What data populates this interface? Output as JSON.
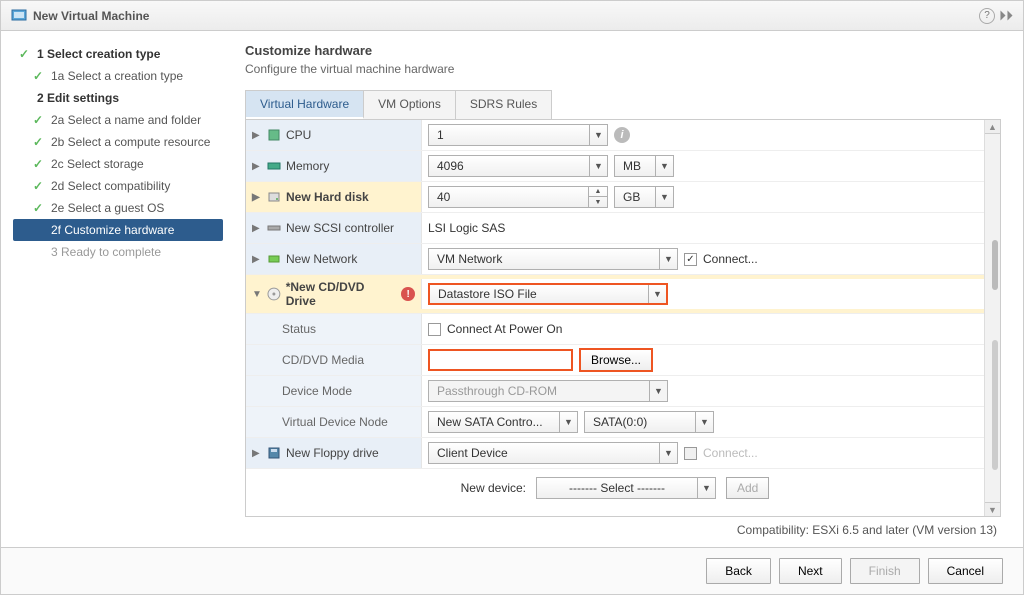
{
  "titlebar": {
    "title": "New Virtual Machine"
  },
  "sidebar": {
    "steps": [
      {
        "label": "1  Select creation type",
        "major": true,
        "check": true
      },
      {
        "label": "1a  Select a creation type",
        "sub": true,
        "check": true
      },
      {
        "label": "2  Edit settings",
        "major": true,
        "check": false
      },
      {
        "label": "2a  Select a name and folder",
        "sub": true,
        "check": true
      },
      {
        "label": "2b  Select a compute resource",
        "sub": true,
        "check": true
      },
      {
        "label": "2c  Select storage",
        "sub": true,
        "check": true
      },
      {
        "label": "2d  Select compatibility",
        "sub": true,
        "check": true
      },
      {
        "label": "2e  Select a guest OS",
        "sub": true,
        "check": true
      },
      {
        "label": "2f  Customize hardware",
        "sub": true,
        "check": false,
        "active": true
      },
      {
        "label": "3  Ready to complete",
        "sub": true,
        "check": false,
        "dim": true
      }
    ]
  },
  "content": {
    "title": "Customize hardware",
    "subtitle": "Configure the virtual machine hardware"
  },
  "tabs": [
    {
      "label": "Virtual Hardware",
      "active": true
    },
    {
      "label": "VM Options"
    },
    {
      "label": "SDRS Rules"
    }
  ],
  "hardware": {
    "cpu": {
      "label": "CPU",
      "value": "1"
    },
    "memory": {
      "label": "Memory",
      "value": "4096",
      "unit": "MB"
    },
    "harddisk": {
      "label": "New Hard disk",
      "value": "40",
      "unit": "GB"
    },
    "scsi": {
      "label": "New SCSI controller",
      "value": "LSI Logic SAS"
    },
    "network": {
      "label": "New Network",
      "value": "VM Network",
      "connect": "Connect...",
      "checked": true
    },
    "cdrom": {
      "label": "*New CD/DVD Drive",
      "value": "Datastore ISO File",
      "status_label": "Status",
      "status_text": "Connect At Power On",
      "media_label": "CD/DVD Media",
      "media_value": "",
      "browse": "Browse...",
      "mode_label": "Device Mode",
      "mode_value": "Passthrough CD-ROM",
      "node_label": "Virtual Device Node",
      "node_controller": "New SATA Contro...",
      "node_port": "SATA(0:0)"
    },
    "floppy": {
      "label": "New Floppy drive",
      "value": "Client Device",
      "connect": "Connect..."
    }
  },
  "new_device": {
    "label": "New device:",
    "select": "------- Select -------",
    "add": "Add"
  },
  "compat": "Compatibility: ESXi 6.5 and later (VM version 13)",
  "footer": {
    "back": "Back",
    "next": "Next",
    "finish": "Finish",
    "cancel": "Cancel"
  }
}
